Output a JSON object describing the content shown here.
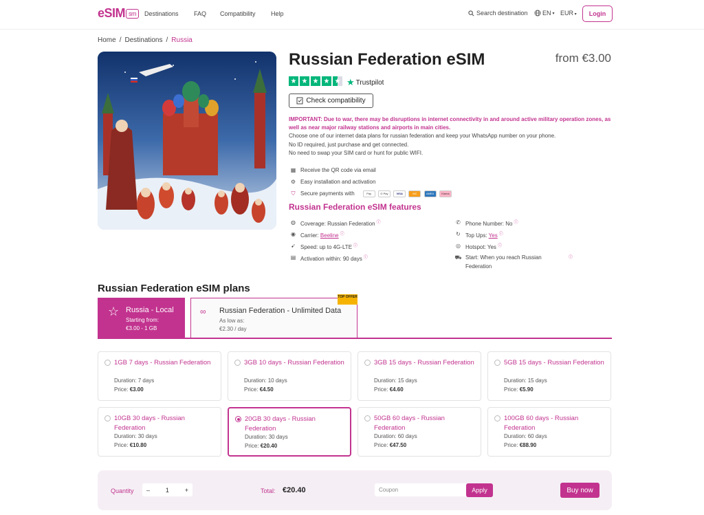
{
  "colors": {
    "accent": "#c2338f",
    "trustpilot": "#00b67a",
    "top_offer": "#f5b300"
  },
  "header": {
    "logo": "eSIM",
    "logo_suffix": "sm",
    "nav": [
      "Destinations",
      "FAQ",
      "Compatibility",
      "Help"
    ],
    "search_label": "Search destination",
    "language": "EN",
    "currency": "EUR",
    "login_label": "Login"
  },
  "breadcrumb": {
    "home": "Home",
    "destinations": "Destinations",
    "current": "Russia",
    "separator": "/"
  },
  "product": {
    "title": "Russian Federation eSIM",
    "price_from": "from €3.00",
    "rating_stars": 4.5,
    "trustpilot": "Trustpilot",
    "check_label": "Check compatibility",
    "important": "IMPORTANT: Due to war, there may be disruptions in internet connectivity in and around active military operation zones, as well as near major railway stations and airports in main cities.",
    "desc": [
      "Choose one of our internet data plans for russian federation and keep your WhatsApp number on your phone.",
      "No ID required, just purchase and get connected.",
      "No need to swap your SIM card or hunt for public WIFI."
    ],
    "bullets": [
      "Receive the QR code via email",
      "Easy installation and activation",
      "Secure payments with"
    ],
    "payment_methods": [
      "Pay",
      "G Pay",
      "VISA",
      "MC",
      "AMEX",
      "Klarna"
    ]
  },
  "features": {
    "title": "Russian Federation eSIM features",
    "coverage_label": "Coverage:",
    "coverage_value": "Russian Federation",
    "carrier_label": "Carrier:",
    "carrier_value": "Beeline",
    "speed_label": "Speed:",
    "speed_value": "up to 4G-LTE",
    "activation_label": "Activation within:",
    "activation_value": "90 days",
    "phone_label": "Phone Number:",
    "phone_value": "No",
    "topups_label": "Top Ups:",
    "topups_value": "Yes",
    "hotspot_label": "Hotspot:",
    "hotspot_value": "Yes",
    "start_label": "Start:",
    "start_value": "When you reach Russian Federation",
    "info_glyph": "ⓘ"
  },
  "plans": {
    "title": "Russian Federation eSIM plans",
    "tab_local": {
      "name": "Russia - Local",
      "sub1": "Starting from:",
      "sub2": "€3.00 - 1 GB"
    },
    "tab_unlimited": {
      "name": "Russian Federation - Unlimited Data",
      "sub1": "As low as:",
      "sub2": "€2.30 / day",
      "badge": "TOP OFFER"
    },
    "duration_label": "Duration:",
    "price_label": "Price:",
    "items": [
      {
        "name": "1GB 7 days - Russian Federation",
        "duration": "7 days",
        "price": "€3.00",
        "selected": false
      },
      {
        "name": "3GB 10 days - Russian Federation",
        "duration": "10 days",
        "price": "€4.50",
        "selected": false
      },
      {
        "name": "3GB 15 days - Russian Federation",
        "duration": "15 days",
        "price": "€4.60",
        "selected": false
      },
      {
        "name": "5GB 15 days - Russian Federation",
        "duration": "15 days",
        "price": "€5.90",
        "selected": false
      },
      {
        "name": "10GB 30 days - Russian Federation",
        "duration": "30 days",
        "price": "€10.80",
        "selected": false
      },
      {
        "name": "20GB 30 days - Russian Federation",
        "duration": "30 days",
        "price": "€20.40",
        "selected": true
      },
      {
        "name": "50GB 60 days - Russian Federation",
        "duration": "60 days",
        "price": "€47.50",
        "selected": false
      },
      {
        "name": "100GB 60 days - Russian Federation",
        "duration": "60 days",
        "price": "€88.90",
        "selected": false
      }
    ]
  },
  "checkout": {
    "quantity_label": "Quantity",
    "minus": "–",
    "plus": "+",
    "quantity": "1",
    "total_label": "Total:",
    "total": "€20.40",
    "coupon_placeholder": "Coupon",
    "apply_label": "Apply",
    "buy_label": "Buy now"
  }
}
